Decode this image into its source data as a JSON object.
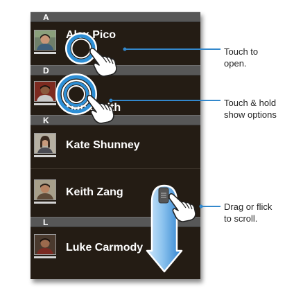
{
  "contacts": {
    "sections": [
      {
        "letter": "A",
        "contacts": [
          {
            "name": "Alex Pico"
          }
        ]
      },
      {
        "letter": "D",
        "contacts": [
          {
            "name": "Dan Smith"
          }
        ]
      },
      {
        "letter": "K",
        "contacts": [
          {
            "name": "Kate Shunney"
          },
          {
            "name": "Keith Zang"
          }
        ]
      },
      {
        "letter": "L",
        "contacts": [
          {
            "name": "Luke Carmody"
          }
        ]
      }
    ]
  },
  "callouts": {
    "open": [
      "Touch to",
      "open."
    ],
    "options": [
      "Touch & hold",
      "show options"
    ],
    "scroll": [
      "Drag or flick",
      "to scroll."
    ]
  },
  "colors": {
    "list_background": "#241c14",
    "section_header": "#575757",
    "touch_ring": "#2e8fd6",
    "scroll_arrow": "#5aa7e2"
  },
  "icons": [
    "contact-photo-icon",
    "touch-ring-icon",
    "hand-pointer-icon",
    "scroll-arrow-icon",
    "scroll-thumb-icon"
  ]
}
